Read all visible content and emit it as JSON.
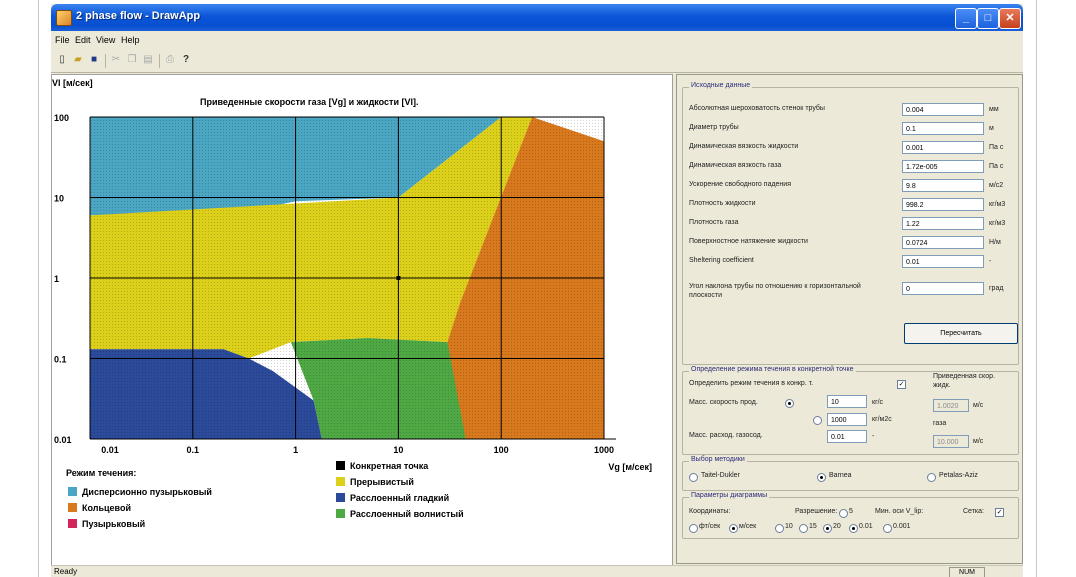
{
  "window": {
    "title": "2 phase flow - DrawApp"
  },
  "menu": [
    "File",
    "Edit",
    "View",
    "Help"
  ],
  "toolbar": {
    "icons": [
      "new-icon",
      "open-icon",
      "save-icon",
      "cut-icon",
      "copy-icon",
      "paste-icon",
      "print-icon",
      "help-icon"
    ]
  },
  "chart": {
    "title": "Приведенные скорости газа [Vg] и жидкости [Vl].",
    "ylabel": "Vl [м/сек]",
    "xlabel": "Vg [м/сек]",
    "yticks": [
      "100",
      "10",
      "1",
      "0.1",
      "0.01"
    ],
    "xticks": [
      "0.01",
      "0.1",
      "1",
      "10",
      "100",
      "1000"
    ],
    "legend_title": "Режим течения:",
    "legend": [
      {
        "label": "Дисперсионно пузырьковый",
        "color": "#4aa6c2"
      },
      {
        "label": "Кольцевой",
        "color": "#d9791e"
      },
      {
        "label": "Пузырьковый",
        "color": "#d4245c"
      },
      {
        "label": "Конкретная точка",
        "color": "#000000"
      },
      {
        "label": "Прерывистый",
        "color": "#dcd01a"
      },
      {
        "label": "Расслоенный гладкий",
        "color": "#2c4a9a"
      },
      {
        "label": "Расслоенный волнистый",
        "color": "#4ea844"
      }
    ]
  },
  "chart_data": {
    "type": "regime_map",
    "title": "Приведенные скорости газа [Vg] и жидкости [Vl].",
    "xlabel": "Vg [м/сек]",
    "ylabel": "Vl [м/сек]",
    "xscale": "log",
    "yscale": "log",
    "xlim": [
      0.01,
      1000
    ],
    "ylim": [
      0.01,
      100
    ],
    "grid": true,
    "point": {
      "x": 10,
      "y": 1
    },
    "regions": [
      {
        "name": "Дисперсионно пузырьковый",
        "approx_vertices": [
          [
            0.01,
            6
          ],
          [
            0.4,
            7
          ],
          [
            1,
            9
          ],
          [
            10,
            10
          ],
          [
            100,
            100
          ],
          [
            0.01,
            100
          ]
        ]
      },
      {
        "name": "Прерывистый",
        "approx_vertices": [
          [
            0.01,
            0.13
          ],
          [
            0.2,
            0.13
          ],
          [
            0.35,
            0.1
          ],
          [
            0.9,
            0.16
          ],
          [
            5,
            0.18
          ],
          [
            30,
            0.16
          ],
          [
            40,
            0.5
          ],
          [
            200,
            100
          ],
          [
            100,
            100
          ],
          [
            10,
            10
          ],
          [
            0.01,
            6
          ]
        ]
      },
      {
        "name": "Расслоенный гладкий",
        "approx_vertices": [
          [
            0.01,
            0.01
          ],
          [
            1.8,
            0.01
          ],
          [
            1.5,
            0.03
          ],
          [
            0.6,
            0.07
          ],
          [
            0.35,
            0.1
          ],
          [
            0.2,
            0.13
          ],
          [
            0.01,
            0.13
          ]
        ]
      },
      {
        "name": "Расслоенный волнистый",
        "approx_vertices": [
          [
            1.8,
            0.01
          ],
          [
            45,
            0.01
          ],
          [
            40,
            0.03
          ],
          [
            30,
            0.16
          ],
          [
            5,
            0.18
          ],
          [
            0.9,
            0.16
          ],
          [
            1.5,
            0.03
          ]
        ]
      },
      {
        "name": "Кольцевой",
        "approx_vertices": [
          [
            45,
            0.01
          ],
          [
            1000,
            0.01
          ],
          [
            1000,
            50
          ],
          [
            200,
            100
          ],
          [
            40,
            0.5
          ],
          [
            30,
            0.16
          ]
        ]
      }
    ]
  },
  "input": {
    "group_title": "Исходные данные",
    "rows": [
      {
        "label": "Абсолютная шероховатость стенок трубы",
        "value": "0.004",
        "unit": "мм"
      },
      {
        "label": "Диаметр трубы",
        "value": "0.1",
        "unit": "м"
      },
      {
        "label": "Динамическая вязкость жидкости",
        "value": "0.001",
        "unit": "Па с"
      },
      {
        "label": "Динамическая вязкость газа",
        "value": "1.72e-005",
        "unit": "Па с"
      },
      {
        "label": "Ускорение свободного падения",
        "value": "9.8",
        "unit": "м/с2"
      },
      {
        "label": "Плотность жидкости",
        "value": "998.2",
        "unit": "кг/м3"
      },
      {
        "label": "Плотность газа",
        "value": "1.22",
        "unit": "кг/м3"
      },
      {
        "label": "Поверхностное натяжение жидкости",
        "value": "0.0724",
        "unit": "Н/м"
      },
      {
        "label": "Sheltering coefficient",
        "value": "0.01",
        "unit": "-"
      },
      {
        "label": "Угол наклона трубы по отношению к горизонтальной плоскости",
        "value": "0",
        "unit": "град"
      }
    ],
    "recalc_label": "Пересчитать"
  },
  "regime": {
    "group_title": "Определение режима течения в конкретной точке",
    "checkbox_label": "Определить режим течения в конкр. т.",
    "checked": true,
    "mass_speed_label": "Масс. скорость прод.",
    "mass_speed_value": "10",
    "mass_speed_unit": "кг/с",
    "mass_flow_value": "1000",
    "mass_flow_unit": "кг/м2с",
    "mass_rate_label": "Масс. расход. газосод.",
    "mass_rate_value": "0.01",
    "mass_rate_unit": "-",
    "reduced_label": "Приведенная скор. жидк.",
    "reduced_liquid_value": "1.0020",
    "reduced_liquid_unit": "м/с",
    "gas_label": "газа",
    "reduced_gas_value": "10.000",
    "reduced_gas_unit": "м/с"
  },
  "method": {
    "group_title": "Выбор методики",
    "options": [
      "Taitel-Dukler",
      "Barnea",
      "Petalas-Aziz"
    ],
    "selected": "Barnea"
  },
  "diagram": {
    "group_title": "Параметры диаграммы",
    "coords_label": "Координаты:",
    "coords_options": [
      "фт/сек",
      "м/сек"
    ],
    "coords_selected": "м/сек",
    "resolution_label": "Разрешение:",
    "resolution_options": [
      "5",
      "10",
      "15",
      "20"
    ],
    "resolution_selected": "20",
    "min_label": "Мин. оси V_lip:",
    "min_options": [
      "0.01",
      "0.001"
    ],
    "min_selected": "0.01",
    "grid_label": "Сетка:",
    "grid_checked": true
  },
  "status": {
    "text": "Ready",
    "num": "NUM"
  }
}
